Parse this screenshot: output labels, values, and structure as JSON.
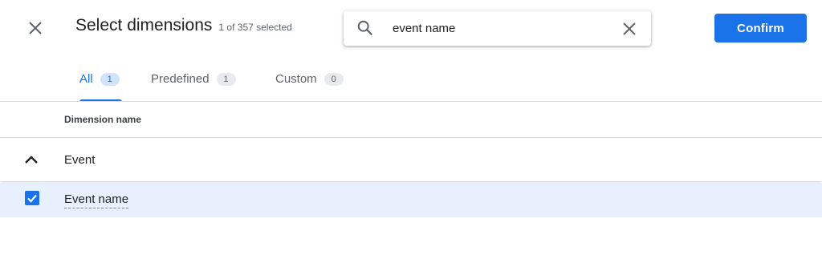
{
  "header": {
    "title": "Select dimensions",
    "selection_count": "1 of 357 selected",
    "close_icon": "close-icon",
    "confirm_label": "Confirm"
  },
  "search": {
    "value": "event name",
    "placeholder": "",
    "search_icon": "search-icon",
    "clear_icon": "clear-icon"
  },
  "tabs": [
    {
      "label": "All",
      "count": "1",
      "active": true
    },
    {
      "label": "Predefined",
      "count": "1",
      "active": false
    },
    {
      "label": "Custom",
      "count": "0",
      "active": false
    }
  ],
  "table": {
    "column_header": "Dimension name",
    "groups": [
      {
        "label": "Event",
        "expanded": true,
        "items": [
          {
            "label": "Event name",
            "checked": true
          }
        ]
      }
    ]
  },
  "colors": {
    "accent": "#1a73e8",
    "selected_row": "#e8f0fe",
    "tab_count_active_bg": "#d2e3fc",
    "tab_count_bg": "#e8eaed"
  }
}
